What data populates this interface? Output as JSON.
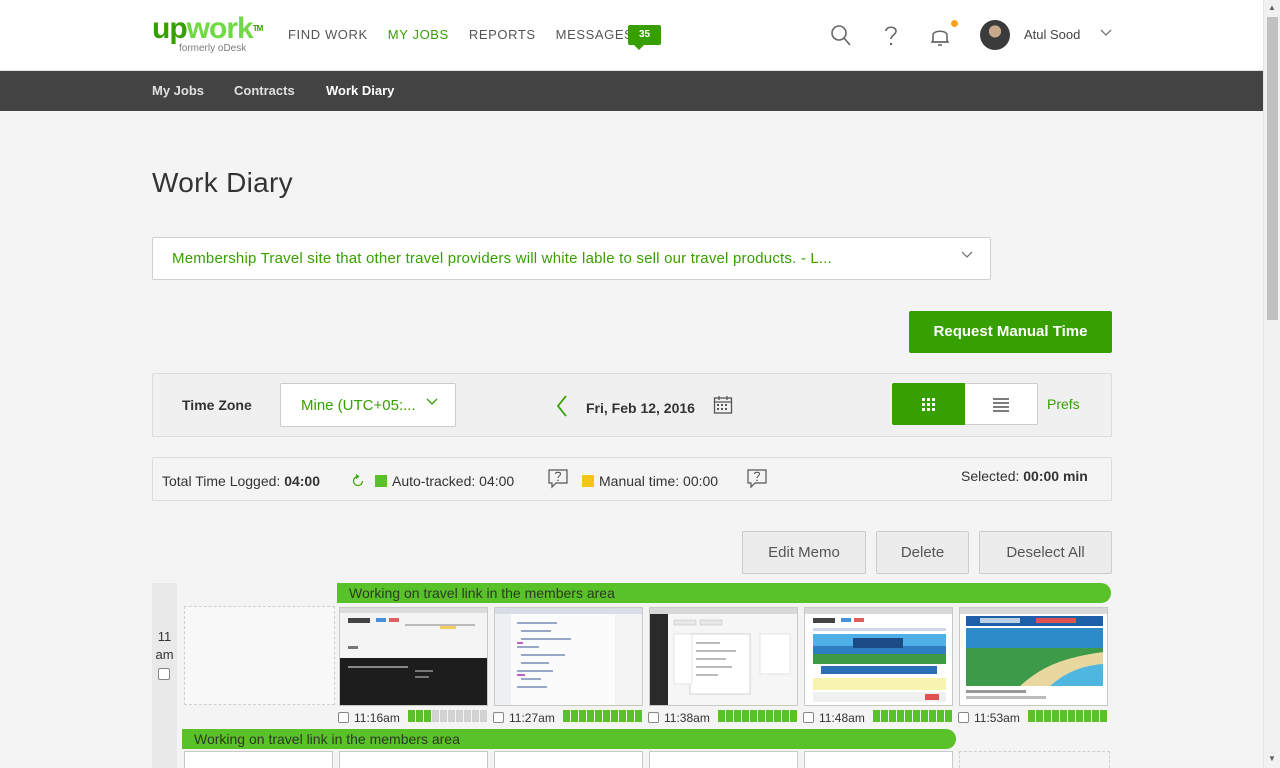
{
  "brand": {
    "logo_text": "upwork",
    "tagline": "formerly oDesk",
    "accent_color": "#37a000",
    "logo_color": "#6fda44"
  },
  "nav": {
    "items": [
      {
        "label": "FIND WORK",
        "active": false
      },
      {
        "label": "MY JOBS",
        "active": true
      },
      {
        "label": "REPORTS",
        "active": false
      },
      {
        "label": "MESSAGES",
        "active": false
      }
    ],
    "messages_count": "35"
  },
  "header_icons": [
    "search-icon",
    "help-icon",
    "bell-icon"
  ],
  "user": {
    "name": "Atul Sood"
  },
  "subnav": {
    "items": [
      {
        "label": "My Jobs"
      },
      {
        "label": "Contracts"
      },
      {
        "label": "Work Diary",
        "active": true
      }
    ]
  },
  "page": {
    "title": "Work Diary"
  },
  "contract": {
    "selected": "Membership Travel site that other travel providers will white lable to sell our travel products. - L..."
  },
  "actions": {
    "request_manual_time": "Request Manual Time"
  },
  "filters": {
    "timezone_label": "Time Zone",
    "timezone_value": "Mine (UTC+05:...",
    "date": "Fri, Feb 12, 2016",
    "prefs_label": "Prefs"
  },
  "totals": {
    "total_label": "Total Time Logged:",
    "total_value": "04:00",
    "auto_label": "Auto-tracked: 04:00",
    "manual_label": "Manual time: 00:00",
    "selected_label": "Selected:",
    "selected_value": "00:00 min",
    "auto_color": "#5ac229",
    "manual_color": "#f5c518"
  },
  "memo_actions": {
    "edit": "Edit Memo",
    "delete": "Delete",
    "deselect": "Deselect All"
  },
  "hour": {
    "label_line1": "11",
    "label_line2": "am",
    "memo_top": "Working on travel link in the members area",
    "memo_bottom": "Working on travel link in the members area",
    "slots": [
      {
        "time": "11:16am",
        "activity": 3
      },
      {
        "time": "11:27am",
        "activity": 10
      },
      {
        "time": "11:38am",
        "activity": 10
      },
      {
        "time": "11:48am",
        "activity": 10
      },
      {
        "time": "11:53am",
        "activity": 10
      }
    ]
  }
}
